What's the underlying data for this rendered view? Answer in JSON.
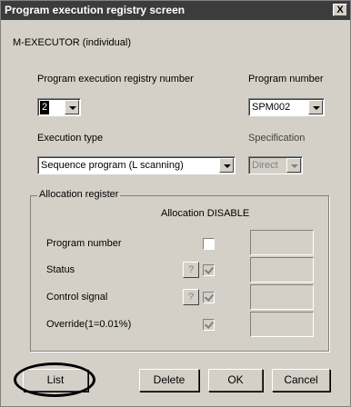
{
  "window": {
    "title": "Program execution registry screen",
    "close_label": "X"
  },
  "header": {
    "mode_label": "M-EXECUTOR (individual)"
  },
  "registry": {
    "label": "Program execution registry number",
    "value": "2"
  },
  "program_number": {
    "label": "Program number",
    "value": "SPM002"
  },
  "execution_type": {
    "label": "Execution type",
    "value": "Sequence program (L scanning)"
  },
  "specification": {
    "label": "Specification",
    "value": "Direct"
  },
  "allocation": {
    "group_title": "Allocation register",
    "disable_label": "Allocation DISABLE",
    "rows": [
      {
        "label": "Program number",
        "help": "",
        "checked": false
      },
      {
        "label": "Status",
        "help": "?",
        "checked": true
      },
      {
        "label": "Control signal",
        "help": "?",
        "checked": true
      },
      {
        "label": "Override(1=0.01%)",
        "help": "",
        "checked": true
      }
    ]
  },
  "buttons": {
    "list": "List",
    "delete": "Delete",
    "ok": "OK",
    "cancel": "Cancel"
  }
}
